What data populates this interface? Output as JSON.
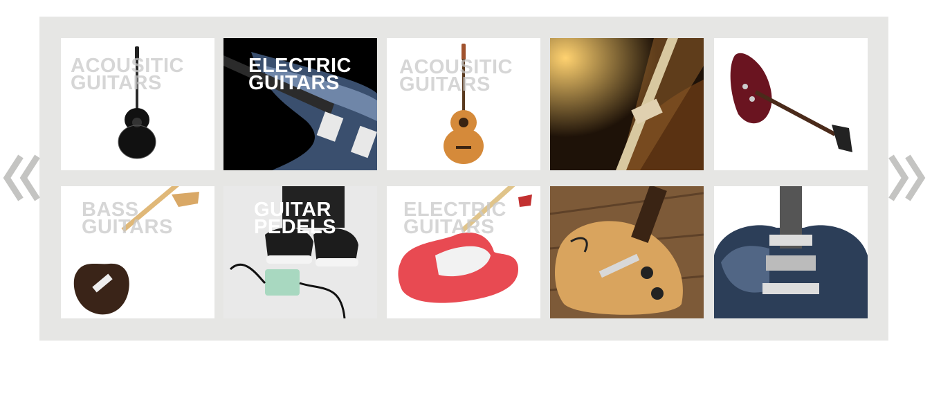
{
  "carousel": {
    "prev_icon": "double-chevron-left-icon",
    "next_icon": "double-chevron-right-icon",
    "colors": {
      "frame": "#e6e6e4",
      "arrow": "#c4c4c2"
    }
  },
  "tiles": [
    {
      "line1": "ACOUSITIC",
      "line2": "GUITARS",
      "image": "acoustic-guitar-black"
    },
    {
      "line1": "ELECTRIC",
      "line2": "GUITARS",
      "image": "electric-guitar-blue"
    },
    {
      "line1": "ACOUSITIC",
      "line2": "GUITARS",
      "image": "acoustic-guitar-natural"
    },
    {
      "line1": "",
      "line2": "",
      "image": "guitar-closeup-warm"
    },
    {
      "line1": "",
      "line2": "",
      "image": "electric-guitar-red"
    },
    {
      "line1": "BASS",
      "line2": "GUITARS",
      "image": "bass-guitar"
    },
    {
      "line1": "GUITAR",
      "line2": "PEDELS",
      "image": "sneakers-guitar-pedal"
    },
    {
      "line1": "ELECTRIC",
      "line2": "GUITARS",
      "image": "electric-guitar-red-white"
    },
    {
      "line1": "",
      "line2": "",
      "image": "hollowbody-guitar-wood"
    },
    {
      "line1": "",
      "line2": "",
      "image": "semi-hollow-guitar-blue"
    }
  ]
}
